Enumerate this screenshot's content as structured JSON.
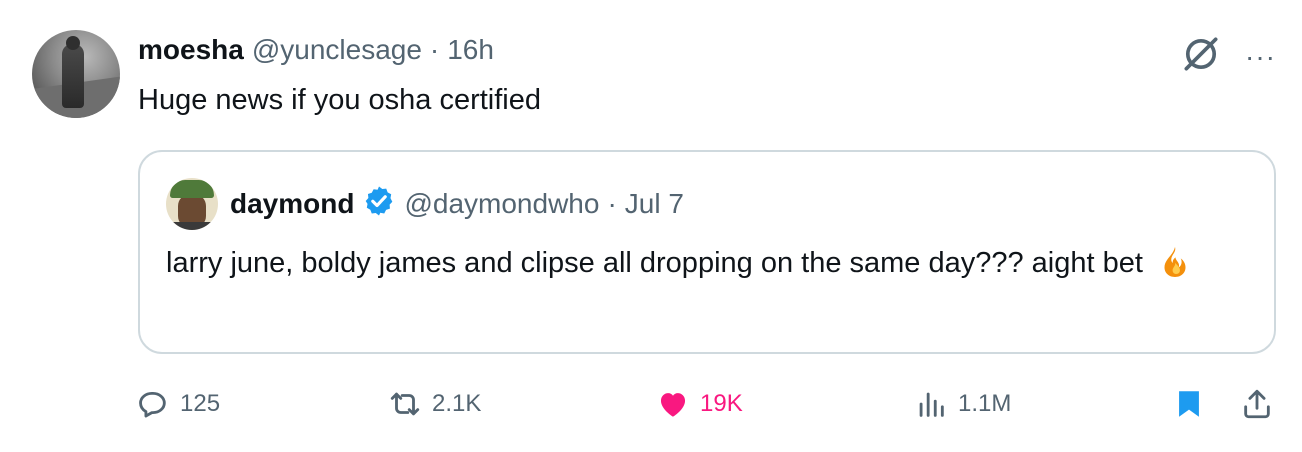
{
  "tweet": {
    "author_name": "moesha",
    "author_handle": "@yunclesage",
    "separator": "·",
    "time": "16h",
    "text": "Huge news if you osha certified",
    "more_label": "···",
    "grok_icon": "grok-icon"
  },
  "quote": {
    "author_name": "daymond",
    "verified": true,
    "author_handle": "@daymondwho",
    "separator": "·",
    "date": "Jul 7",
    "text": "larry june, boldy james and clipse all dropping on the same day??? aight bet",
    "emoji": "fire"
  },
  "actions": {
    "replies": "125",
    "retweets": "2.1K",
    "likes": "19K",
    "views": "1.1M",
    "bookmarked": true
  },
  "colors": {
    "secondary_text": "#536471",
    "like_pink": "#f91880",
    "verified_blue": "#1d9bf0",
    "border": "#cfd9de"
  }
}
